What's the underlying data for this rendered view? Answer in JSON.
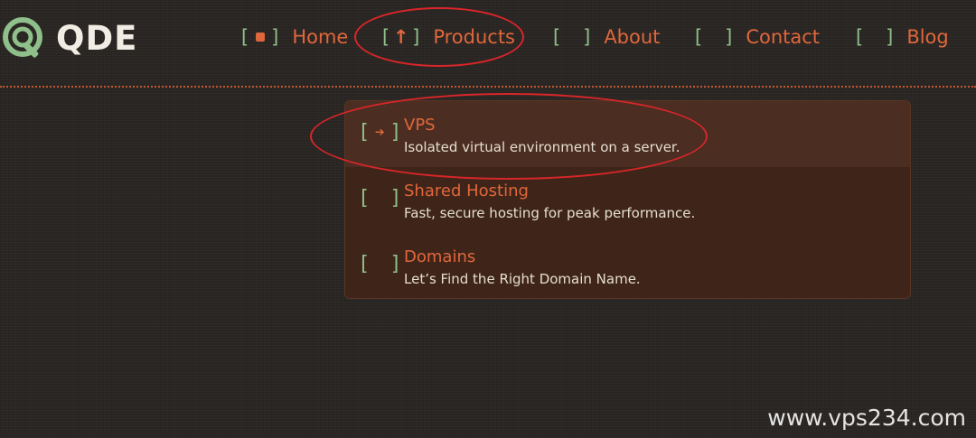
{
  "logo": {
    "text": "QDE"
  },
  "nav": {
    "items": [
      {
        "label": "Home",
        "marker": "square-icon"
      },
      {
        "label": "Products",
        "marker": "↑"
      },
      {
        "label": "About",
        "marker": ""
      },
      {
        "label": "Contact",
        "marker": ""
      },
      {
        "label": "Blog",
        "marker": ""
      }
    ]
  },
  "dropdown": {
    "items": [
      {
        "title": "VPS",
        "description": "Isolated virtual environment on a server.",
        "marker": "➔",
        "active": true
      },
      {
        "title": "Shared Hosting",
        "description": "Fast, secure hosting for peak performance.",
        "marker": "",
        "active": false
      },
      {
        "title": "Domains",
        "description": "Let’s Find the Right Domain Name.",
        "marker": "",
        "active": false
      }
    ]
  },
  "brackets": {
    "open": "[",
    "close": "]"
  },
  "watermark": "www.vps234.com",
  "colors": {
    "background": "#2a2623",
    "accent_orange": "#e0673c",
    "bracket_green": "#8fbf8a",
    "dropdown_bg": "#3f2519",
    "annotation_red": "#d8262a"
  }
}
